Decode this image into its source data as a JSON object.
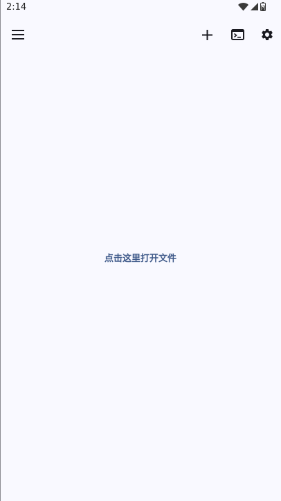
{
  "status_bar": {
    "time": "2:14",
    "icons": [
      "wifi-icon",
      "cell-signal-icon",
      "battery-icon"
    ]
  },
  "toolbar": {
    "menu_icon": "menu-icon",
    "add_icon": "add-icon",
    "terminal_icon": "terminal-icon",
    "settings_icon": "settings-icon"
  },
  "main": {
    "open_file_hint": "点击这里打开文件"
  },
  "colors": {
    "background": "#f9f9ff",
    "hint_text": "#3f5a8a",
    "icon": "#1b1b21"
  }
}
